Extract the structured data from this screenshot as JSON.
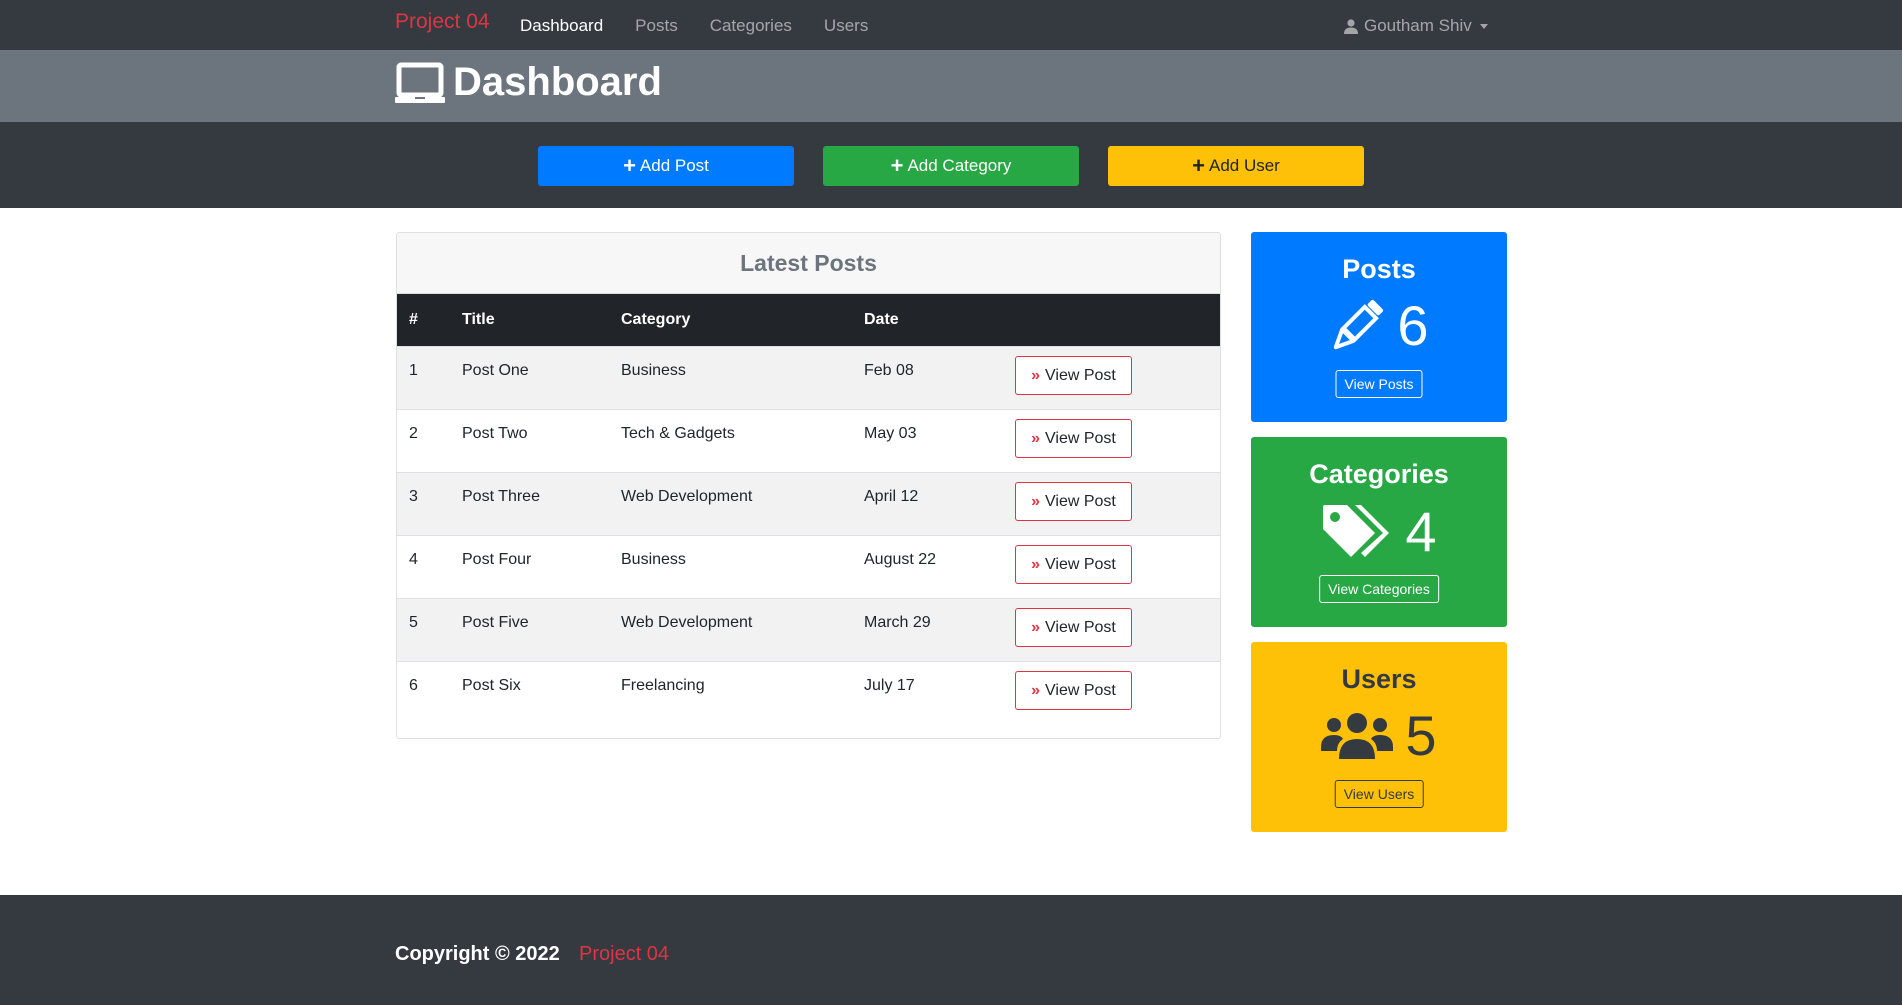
{
  "navbar": {
    "brand": "Project 04",
    "links": [
      "Dashboard",
      "Posts",
      "Categories",
      "Users"
    ],
    "active": "Dashboard",
    "user": "Goutham Shiv"
  },
  "header": {
    "title": "Dashboard",
    "icon": "laptop-icon"
  },
  "actions": {
    "add_post": "Add Post",
    "add_category": "Add Category",
    "add_user": "Add User"
  },
  "latest_posts": {
    "title": "Latest Posts",
    "columns": [
      "#",
      "Title",
      "Category",
      "Date"
    ],
    "view_label": "View Post",
    "rows": [
      {
        "num": "1",
        "title": "Post One",
        "category": "Business",
        "date": "Feb 08"
      },
      {
        "num": "2",
        "title": "Post Two",
        "category": "Tech & Gadgets",
        "date": "May 03"
      },
      {
        "num": "3",
        "title": "Post Three",
        "category": "Web Development",
        "date": "April 12"
      },
      {
        "num": "4",
        "title": "Post Four",
        "category": "Business",
        "date": "August 22"
      },
      {
        "num": "5",
        "title": "Post Five",
        "category": "Web Development",
        "date": "March 29"
      },
      {
        "num": "6",
        "title": "Post Six",
        "category": "Freelancing",
        "date": "July 17"
      }
    ]
  },
  "stats": {
    "posts": {
      "title": "Posts",
      "count": "6",
      "button": "View Posts",
      "icon": "pencil-icon",
      "color": "#007bff"
    },
    "categories": {
      "title": "Categories",
      "count": "4",
      "button": "View Categories",
      "icon": "tags-icon",
      "color": "#28a745"
    },
    "users": {
      "title": "Users",
      "count": "5",
      "button": "View Users",
      "icon": "users-icon",
      "color": "#ffc107"
    }
  },
  "footer": {
    "copyright": "Copyright © 2022",
    "brand": "Project 04"
  },
  "colors": {
    "brand": "#dc3545",
    "dark": "#343a40",
    "gray": "#6c757d"
  }
}
